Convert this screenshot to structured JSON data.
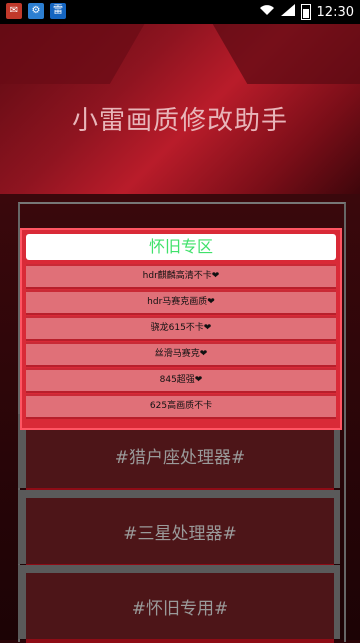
{
  "status_bar": {
    "time": "12:30"
  },
  "header": {
    "title": "小雷画质修改助手"
  },
  "dialog": {
    "title": "怀旧专区",
    "items": [
      {
        "label": "hdr麒麟高清不卡❤"
      },
      {
        "label": "hdr马赛克画质❤"
      },
      {
        "label": "骁龙615不卡❤"
      },
      {
        "label": "丝滑马赛克❤"
      },
      {
        "label": "845超强❤"
      },
      {
        "label": "625高画质不卡"
      }
    ]
  },
  "menu": {
    "items": [
      {
        "label": "#猎户座处理器#"
      },
      {
        "label": "#三星处理器#"
      },
      {
        "label": "#怀旧专用#"
      }
    ]
  }
}
